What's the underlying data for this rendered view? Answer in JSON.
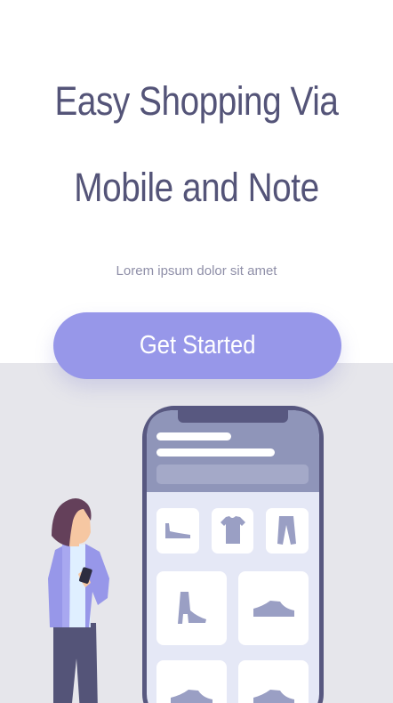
{
  "hero": {
    "title_line1": "Easy Shopping Via",
    "title_line2": "Mobile and Note",
    "subtitle": "Lorem ipsum dolor sit amet",
    "cta_label": "Get Started"
  },
  "illustration": {
    "phone_frame_color": "#585880",
    "phone_header_color": "#8f95b9",
    "phone_screen_color": "#e5e8f6",
    "product_color": "#9a9fc4",
    "products": [
      "flat-shoe-icon",
      "tshirt-icon",
      "pants-icon",
      "high-heel-icon",
      "sneaker-icon",
      "sneaker-icon",
      "sneaker-icon"
    ]
  },
  "colors": {
    "title": "#545478",
    "subtitle": "#8f8fa8",
    "cta": "#9797e9",
    "background_lower": "#e6e6eb"
  }
}
